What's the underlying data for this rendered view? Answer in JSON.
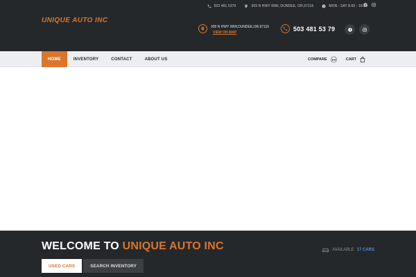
{
  "brand": {
    "name": "UNIQUE AUTO INC",
    "accent": "#d9762b",
    "dark_bg": "#25282b",
    "link_blue": "#4f8fd6"
  },
  "topbar": {
    "phone": "503 481 5379",
    "address": "309 N HWY 99W, DUNDEE, OR,97115",
    "hours": "MON - SAT 8.00 - 18.00",
    "icons": [
      "phone-icon",
      "location-pin-icon",
      "clock-icon",
      "facebook-icon",
      "instagram-icon"
    ]
  },
  "header": {
    "address_text": "309 N HWY 99W,DUNDEE,OR,97115",
    "view_map": "VIEW ON MAP",
    "phone": "503 481 53 79"
  },
  "nav": {
    "items": [
      {
        "label": "HOME",
        "active": true
      },
      {
        "label": "INVENTORY",
        "active": false
      },
      {
        "label": "CONTACT",
        "active": false
      },
      {
        "label": "ABOUT US",
        "active": false
      }
    ],
    "compare": "COMPARE",
    "cart": "CART"
  },
  "welcome": {
    "title_prefix": "WELCOME TO",
    "title_brand": "UNIQUE AUTO INC",
    "available_label": "AVAILABLE",
    "available_count": "17 CARS",
    "tabs": [
      {
        "label": "USED CARS",
        "active": true
      },
      {
        "label": "SEARCH INVENTORY",
        "active": false
      }
    ]
  }
}
